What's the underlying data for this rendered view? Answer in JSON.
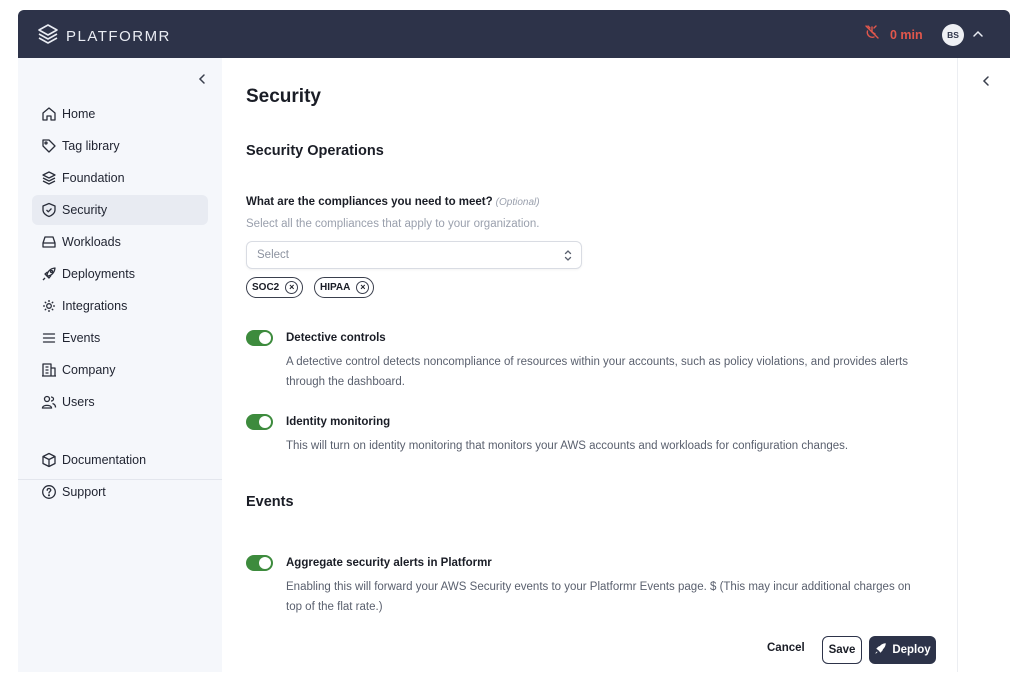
{
  "header": {
    "logo_text": "PLATFORMR",
    "timer_text": "0 min",
    "avatar_initials": "BS",
    "icons": [
      "logo-layers-icon",
      "no-clock-icon",
      "chevron-up-icon"
    ],
    "colors": {
      "bar": "#2d3349",
      "timer": "#e2574c"
    }
  },
  "sidebar": {
    "items": [
      {
        "label": "Home",
        "icon": "home-icon"
      },
      {
        "label": "Tag library",
        "icon": "tag-icon"
      },
      {
        "label": "Foundation",
        "icon": "layers-icon"
      },
      {
        "label": "Security",
        "icon": "shield-icon",
        "active": true
      },
      {
        "label": "Workloads",
        "icon": "hard-drive-icon"
      },
      {
        "label": "Deployments",
        "icon": "rocket-icon"
      },
      {
        "label": "Integrations",
        "icon": "integrations-icon"
      },
      {
        "label": "Events",
        "icon": "list-icon"
      },
      {
        "label": "Company",
        "icon": "building-icon"
      },
      {
        "label": "Users",
        "icon": "users-icon"
      }
    ],
    "bottom_items": [
      {
        "label": "Documentation",
        "icon": "box-icon"
      },
      {
        "label": "Support",
        "icon": "help-icon"
      }
    ]
  },
  "main": {
    "title": "Security",
    "security_operations": {
      "heading": "Security Operations",
      "compliance_question": "What are the compliances you need to meet?",
      "optional_tag": "(Optional)",
      "compliance_help": "Select all the compliances that apply to your organization.",
      "select_placeholder": "Select",
      "chips": [
        "SOC2",
        "HIPAA"
      ],
      "chip_remove_glyph": "×"
    },
    "detective_controls": {
      "label": "Detective controls",
      "enabled": true,
      "description_line1": "A detective control detects noncompliance of resources within your accounts, such as policy violations, and provides alerts",
      "description_line2": "through the dashboard."
    },
    "identity_monitoring": {
      "label": "Identity monitoring",
      "enabled": true,
      "description": "This will turn on identity monitoring that monitors your AWS accounts and workloads for configuration changes."
    },
    "events": {
      "heading": "Events",
      "aggregate_label": "Aggregate security alerts in Platformr",
      "enabled": true,
      "description_line1": "Enabling this will forward your AWS Security events to your Platformr Events page. $ (This may incur additional charges on",
      "description_line2": "top of the flat rate.)"
    },
    "actions": {
      "cancel": "Cancel",
      "save": "Save",
      "deploy": "Deploy"
    },
    "colors": {
      "toggle_on": "#3d8b3d",
      "deploy_bg": "#2d3349"
    }
  }
}
